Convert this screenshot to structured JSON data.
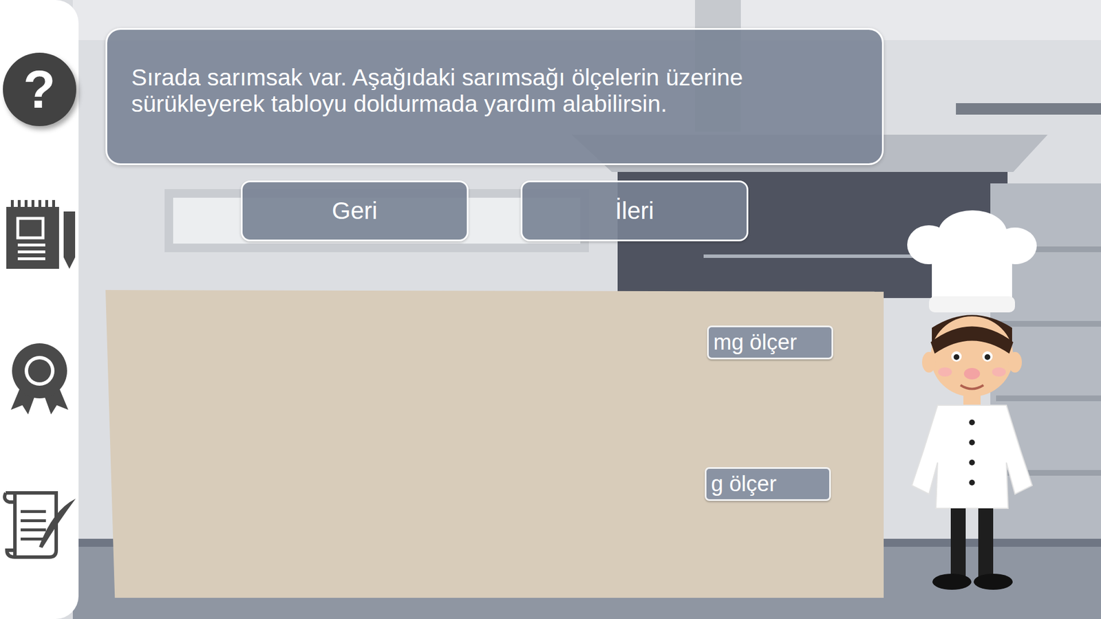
{
  "sidebar": {
    "help_glyph": "?"
  },
  "dialog": {
    "text": "Sırada sarımsak var. Aşağıdaki sarımsağı ölçelerin üzerine sürükleyerek tabloyu doldurmada yardım alabilirsin."
  },
  "nav_buttons": [
    {
      "label": "Geri"
    },
    {
      "label": "İleri"
    }
  ],
  "tools": [
    {
      "label": "mg ölçer"
    },
    {
      "label": "g ölçer"
    }
  ]
}
